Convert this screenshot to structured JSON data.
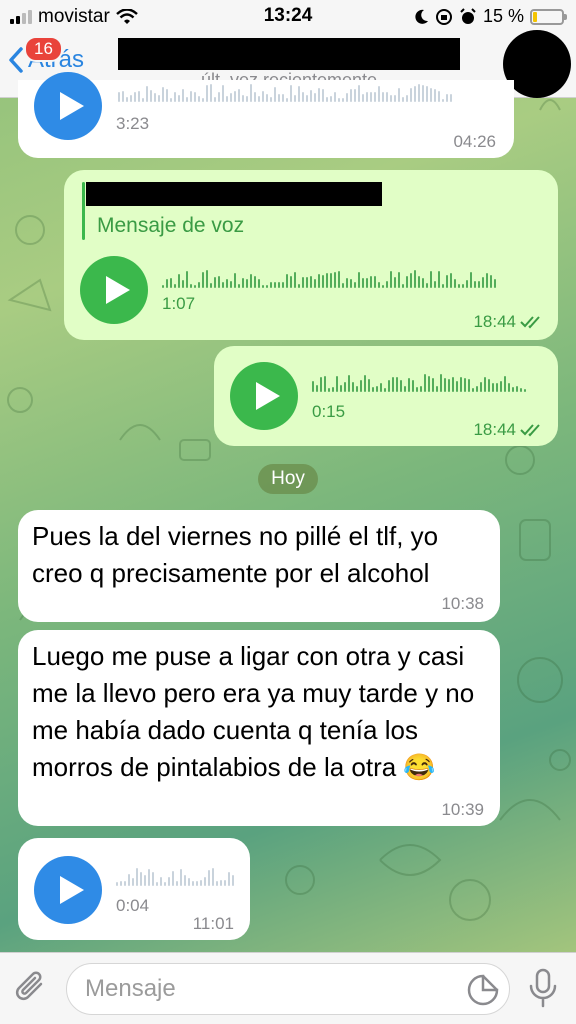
{
  "status_bar": {
    "carrier": "movistar",
    "time": "13:24",
    "battery": "15 %",
    "battery_level": 0.15,
    "battery_color": "#f4c400"
  },
  "header": {
    "back_label": "Atrás",
    "unread_badge": "16",
    "last_seen": "últ. vez recientemente",
    "accent_color": "#2a85e0"
  },
  "messages": [
    {
      "type": "voice",
      "direction": "incoming",
      "duration": "3:23",
      "time": "04:26"
    },
    {
      "type": "voice",
      "direction": "outgoing",
      "reply_label": "Mensaje de voz",
      "duration": "1:07",
      "time": "18:44",
      "status": "read"
    },
    {
      "type": "voice",
      "direction": "outgoing",
      "duration": "0:15",
      "time": "18:44",
      "status": "read"
    },
    {
      "type": "date",
      "label": "Hoy"
    },
    {
      "type": "text",
      "direction": "incoming",
      "text": "Pues la del viernes no pillé el tlf, yo creo q precisamente por el alcohol",
      "time": "10:38"
    },
    {
      "type": "text",
      "direction": "incoming",
      "text": "Luego me puse a ligar con otra y casi me la llevo pero era ya muy tarde y no me había dado cuenta q tenía los morros de pintalabios de la otra 😂",
      "time": "10:39"
    },
    {
      "type": "voice",
      "direction": "incoming",
      "duration": "0:04",
      "time": "11:01"
    }
  ],
  "input": {
    "placeholder": "Mensaje"
  },
  "icons": [
    "signal-icon",
    "wifi-icon",
    "moon-icon",
    "orientation-lock-icon",
    "alarm-icon",
    "battery-icon",
    "chevron-left-icon",
    "play-icon",
    "double-check-icon",
    "paperclip-icon",
    "sticker-icon",
    "microphone-icon"
  ]
}
